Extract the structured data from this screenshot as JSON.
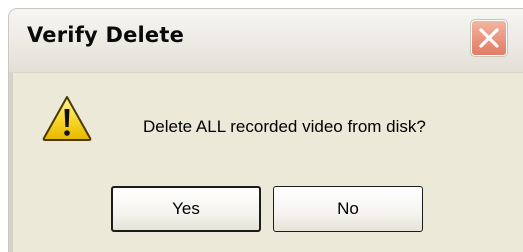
{
  "dialog": {
    "title": "Verify Delete",
    "message": "Delete ALL recorded video from disk?",
    "icon": "warning-icon",
    "buttons": {
      "yes": "Yes",
      "no": "No"
    }
  },
  "colors": {
    "dialog_background": "#ece9d8",
    "close_button": "#e8907a",
    "warning_yellow": "#f7d629"
  }
}
